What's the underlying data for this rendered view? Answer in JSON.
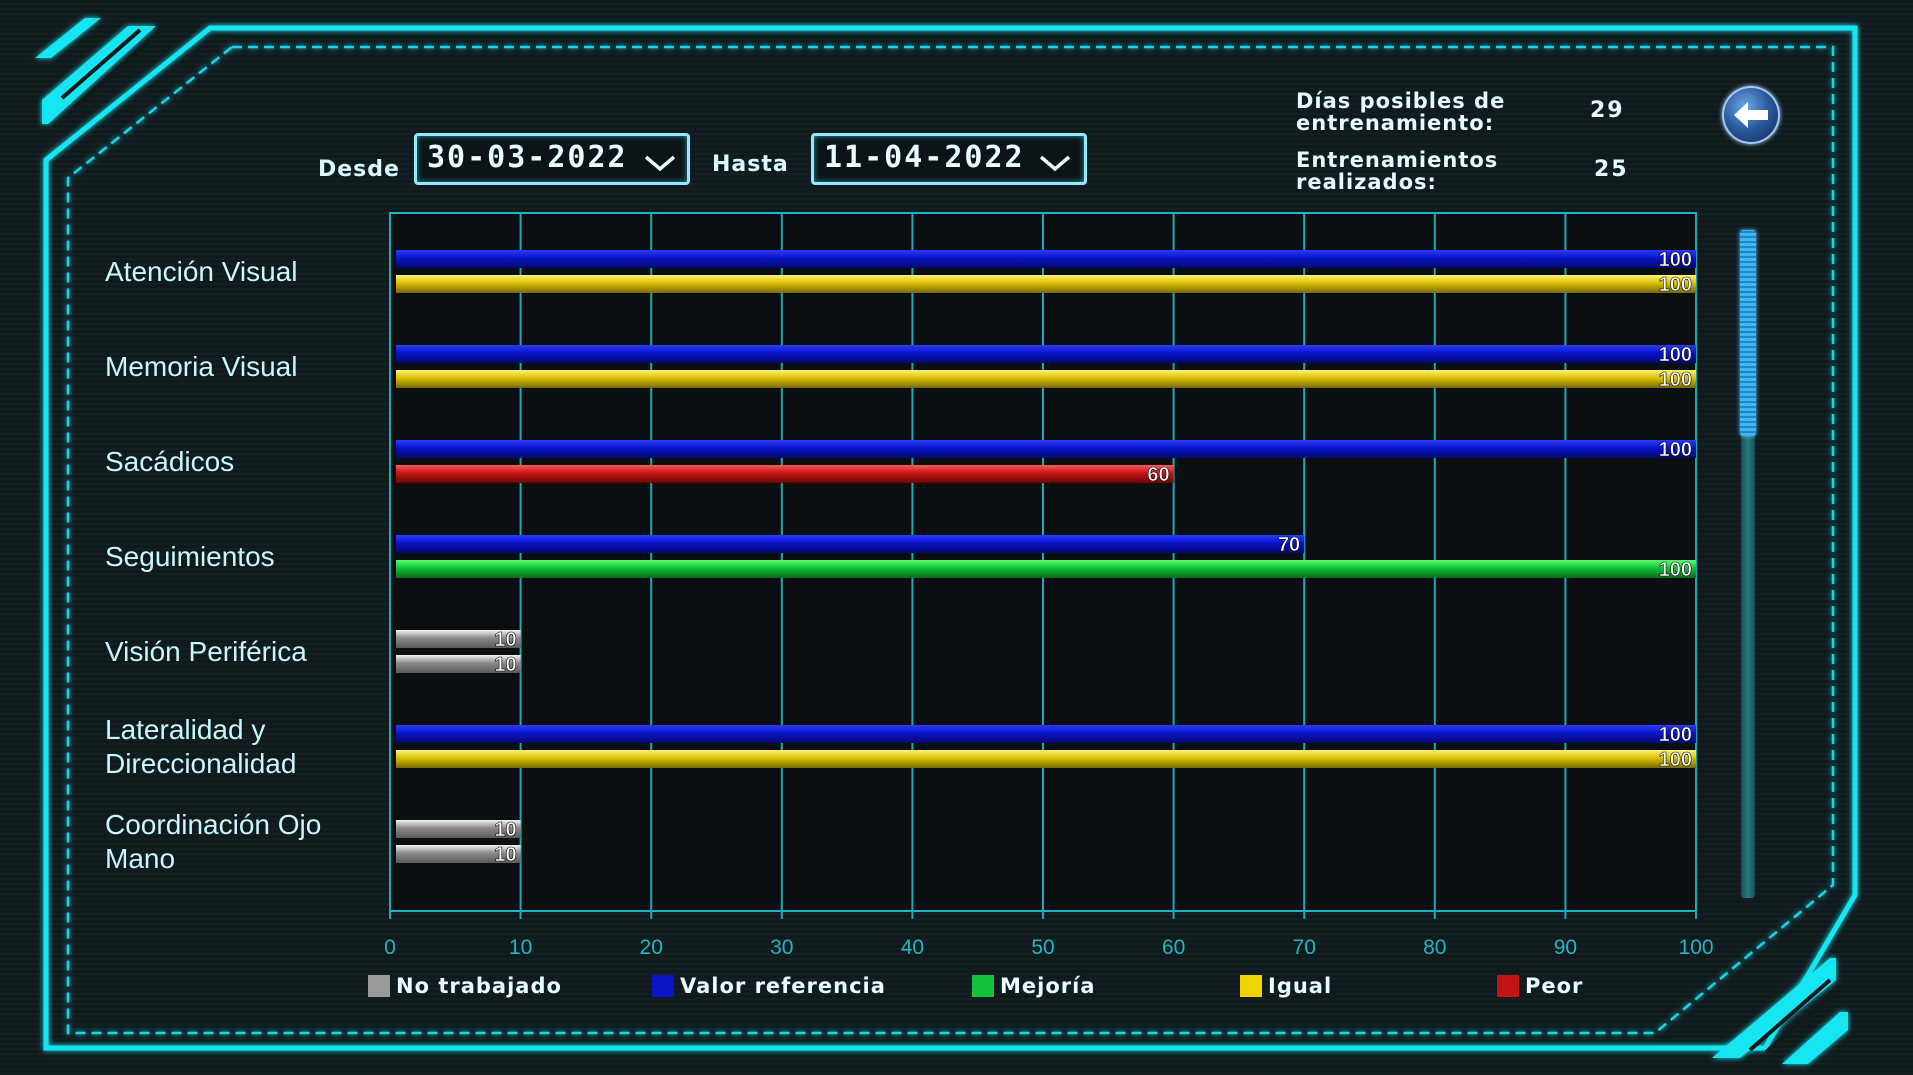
{
  "header": {
    "desde_label": "Desde",
    "desde_value": "30-03-2022",
    "hasta_label": "Hasta",
    "hasta_value": "11-04-2022",
    "dias_label_line1": "Días posibles de",
    "dias_label_line2": "entrenamiento:",
    "dias_value": "29",
    "entren_label_line1": "Entrenamientos",
    "entren_label_line2": "realizados:",
    "entren_value": "25",
    "back_icon": "back-arrow-icon"
  },
  "categories": [
    {
      "line1": "Atención Visual",
      "line2": ""
    },
    {
      "line1": "Memoria Visual",
      "line2": ""
    },
    {
      "line1": "Sacádicos",
      "line2": ""
    },
    {
      "line1": "Seguimientos",
      "line2": ""
    },
    {
      "line1": "Visión Periférica",
      "line2": ""
    },
    {
      "line1": "Lateralidad y",
      "line2": "Direccionalidad"
    },
    {
      "line1": "Coordinación Ojo",
      "line2": "Mano"
    },
    {
      "line1": "Memoria Visual",
      "line2": ""
    }
  ],
  "legend": [
    {
      "label": "No trabajado",
      "color": "#9a9a9a"
    },
    {
      "label": "Valor referencia",
      "color": "#0a14c8"
    },
    {
      "label": "Mejoría",
      "color": "#12c23a"
    },
    {
      "label": "Igual",
      "color": "#f0d400"
    },
    {
      "label": "Peor",
      "color": "#c41414"
    }
  ],
  "chart_data": {
    "type": "bar",
    "orientation": "horizontal",
    "categories": [
      "Atención Visual",
      "Memoria Visual",
      "Sacádicos",
      "Seguimientos",
      "Visión Periférica",
      "Lateralidad y Direccionalidad",
      "Coordinación Ojo Mano"
    ],
    "series": [
      {
        "name": "Valor referencia",
        "values": [
          100,
          100,
          100,
          70,
          10,
          100,
          10
        ],
        "status": [
          "Valor referencia",
          "Valor referencia",
          "Valor referencia",
          "Valor referencia",
          "No trabajado",
          "Valor referencia",
          "No trabajado"
        ]
      },
      {
        "values": [
          100,
          100,
          60,
          100,
          10,
          100,
          10
        ],
        "status": [
          "Igual",
          "Igual",
          "Peor",
          "Mejoría",
          "No trabajado",
          "Igual",
          "No trabajado"
        ]
      }
    ],
    "xlim": [
      0,
      100
    ],
    "xticks": [
      0,
      10,
      20,
      30,
      40,
      50,
      60,
      70,
      80,
      90,
      100
    ],
    "grid": true,
    "legend_position": "bottom"
  }
}
